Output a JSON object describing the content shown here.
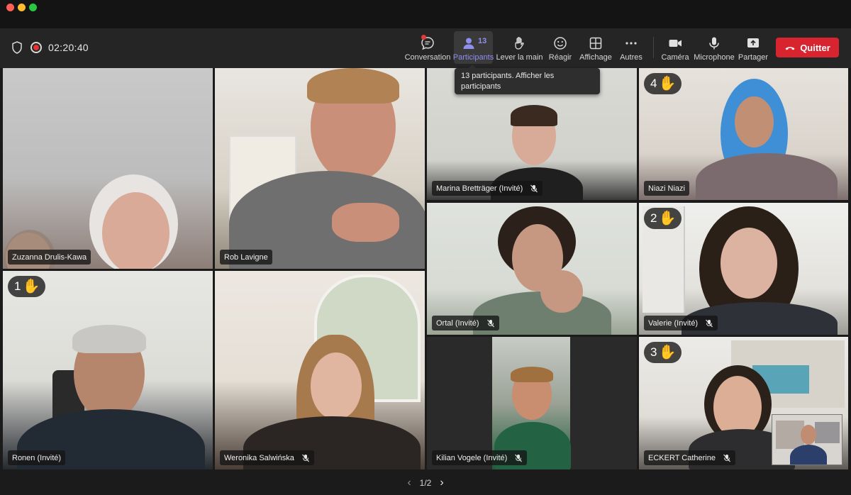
{
  "toolbar": {
    "timer": "02:20:40",
    "buttons": {
      "conversation": "Conversation",
      "participants": "Participants",
      "participants_count": "13",
      "raise_hand": "Lever la main",
      "react": "Réagir",
      "view": "Affichage",
      "more": "Autres",
      "camera": "Caméra",
      "microphone": "Microphone",
      "share": "Partager"
    },
    "quit_label": "Quitter"
  },
  "tooltip": "13 participants. Afficher les participants",
  "tiles": {
    "t1": {
      "name": "Zuzanna Drulis-Kawa"
    },
    "t2": {
      "name": "Rob Lavigne"
    },
    "t3": {
      "name": "Marina Bretträger (Invité)"
    },
    "t4": {
      "name": "Niazi Niazi",
      "hand": "4"
    },
    "t5": {
      "name": "Ortal (Invité)"
    },
    "t6": {
      "name": "Valerie (Invité)",
      "hand": "2"
    },
    "t7": {
      "name": "Ronen (Invité)",
      "hand": "1"
    },
    "t8": {
      "name": "Weronika Salwińska"
    },
    "t9": {
      "name": "Kilian Vogele (Invité)"
    },
    "t10": {
      "name": "ECKERT Catherine",
      "hand": "3"
    }
  },
  "pager": {
    "label": "1/2"
  },
  "colors": {
    "highlight": "#e8b43a",
    "active_speaker": "#7d6ff0",
    "quit": "#d7242f",
    "accent": "#8f8ff0"
  },
  "icons": [
    "shield-icon",
    "record-icon",
    "chat-icon",
    "person-icon",
    "hand-icon",
    "smile-icon",
    "grid-icon",
    "more-icon",
    "camera-icon",
    "mic-icon",
    "share-icon",
    "phone-icon",
    "mic-muted-icon"
  ]
}
